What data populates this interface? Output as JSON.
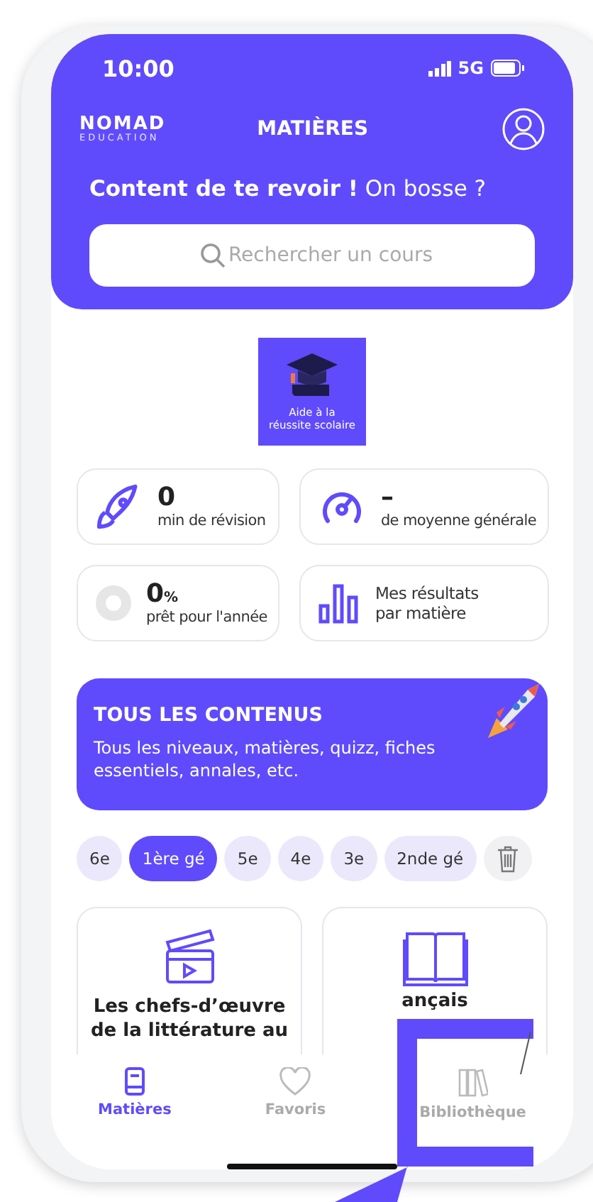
{
  "status_bar": {
    "time": "10:00",
    "network": "5G"
  },
  "header": {
    "logo": {
      "name": "NOMAD",
      "sub": "EDUCATION"
    },
    "title": "MATIÈRES",
    "greeting": "**Content de te revoir  !** On bosse ?"
  },
  "search": {
    "placeholder": "Rechercher un cours"
  },
  "badge": {
    "text": "Aide à la réussite scolaire"
  },
  "stats": [
    {
      "kind": "rocket",
      "value": "0",
      "label": "min de révision"
    },
    {
      "kind": "gauge",
      "value": "–",
      "label": "de moyenne générale"
    },
    {
      "kind": "ring",
      "value": "0",
      "unit": "%",
      "label": "prêt pour l'année"
    },
    {
      "kind": "bars",
      "label": "Mes résultats par matière"
    }
  ],
  "banner": {
    "title": "TOUS LES CONTENUS",
    "text": "Tous les niveaux, matières, quizz, fiches essentiels, annales, etc."
  },
  "levels": [
    {
      "label": "6e",
      "selected": false
    },
    {
      "label": "1ère gé",
      "selected": true
    },
    {
      "label": "5e",
      "selected": false
    },
    {
      "label": "4e",
      "selected": false
    },
    {
      "label": "3e",
      "selected": false
    },
    {
      "label": "2nde gé",
      "selected": false
    }
  ],
  "courses": [
    {
      "kind": "film",
      "title": "Les chefs-d’œuvre de la littérature au"
    },
    {
      "kind": "book",
      "title": "ançais"
    }
  ],
  "tabs": [
    {
      "kind": "book",
      "label": "Matières",
      "selected": true
    },
    {
      "kind": "heart",
      "label": "Favoris",
      "selected": false
    },
    {
      "kind": "shelf",
      "label": "Bibliothèque",
      "selected": false
    }
  ]
}
